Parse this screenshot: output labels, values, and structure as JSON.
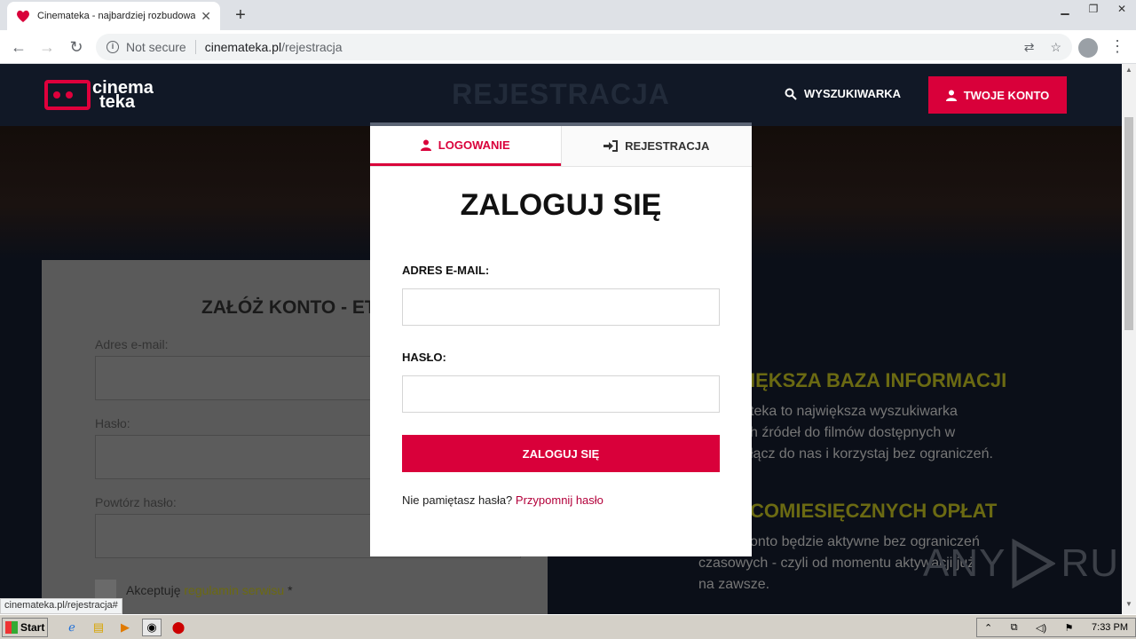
{
  "browser": {
    "tab_title": "Cinemateka - najbardziej rozbudowa",
    "tab_close": "✕",
    "new_tab": "+",
    "address": {
      "security": "Not secure",
      "host": "cinemateka.pl",
      "path": "/rejestracja"
    },
    "status_url": "cinemateka.pl/rejestracja#"
  },
  "site": {
    "logo_line1": "cinema",
    "logo_line2": "teka",
    "page_title": "REJESTRACJA",
    "search_label": "WYSZUKIWARKA",
    "account_label": "TWOJE KONTO"
  },
  "register": {
    "heading": "ZAŁÓŻ KONTO - ETAP",
    "email_label": "Adres e-mail:",
    "password_label": "Hasło:",
    "repeat_label": "Powtórz hasło:",
    "accept_text": "Akceptuję ",
    "accept_link": "regulamin serwisu",
    "accept_star": " *"
  },
  "features": [
    {
      "title": "IĘKSZA BAZA INFORMACJI",
      "lines": [
        "teka to największa wyszukiwarka",
        "h źródeł do filmów dostępnych w",
        "łącz do nas i korzystaj bez ograniczeń."
      ]
    },
    {
      "title": "COMIESIĘCZNYCH OPŁAT",
      "lines": [
        "onto będzie aktywne bez ograniczeń",
        "czasowych - czyli od momentu aktywacji już",
        "na zawsze."
      ]
    }
  ],
  "watermark": {
    "left": "ANY",
    "right": "RUN"
  },
  "modal": {
    "tab_login": "LOGOWANIE",
    "tab_register": "REJESTRACJA",
    "heading": "ZALOGUJ SIĘ",
    "email_label": "ADRES E-MAIL:",
    "email_value": "",
    "password_label": "HASŁO:",
    "password_value": "",
    "submit_label": "ZALOGUJ SIĘ",
    "forgot_text": "Nie pamiętasz hasła? ",
    "forgot_link": "Przypomnij hasło"
  },
  "taskbar": {
    "start": "Start",
    "time": "7:33 PM"
  },
  "colors": {
    "brand": "#d9003a",
    "header": "#111826",
    "overlay": "#0b0f18"
  }
}
